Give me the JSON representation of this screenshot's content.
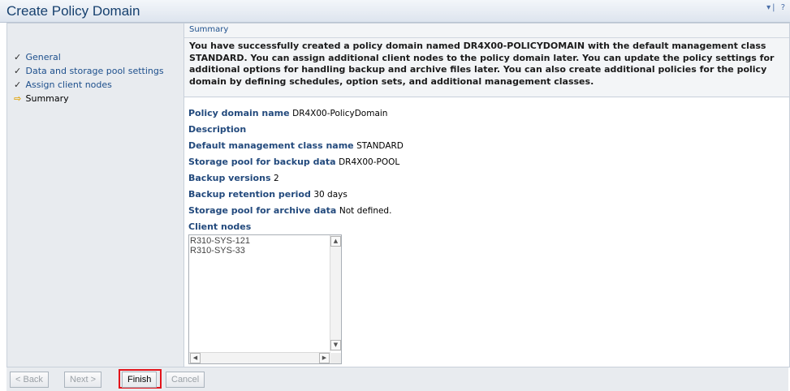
{
  "window": {
    "title": "Create Policy Domain",
    "controls": "▾| ?"
  },
  "sidebar": {
    "steps": [
      {
        "label": "General",
        "mark": "✓"
      },
      {
        "label": "Data and storage pool settings",
        "mark": "✓"
      },
      {
        "label": "Assign client nodes",
        "mark": "✓"
      },
      {
        "label": "Summary",
        "mark": "⇨"
      }
    ]
  },
  "main": {
    "breadcrumb": "Summary",
    "message": "You have successfully created a policy domain named DR4X00-POLICYDOMAIN with the default management class STANDARD. You can assign additional client nodes to the policy domain later. You can update the policy settings for additional options for handling backup and archive files later. You can also create additional policies for the policy domain by defining schedules, option sets, and additional management classes.",
    "fields": [
      {
        "label": "Policy domain name",
        "value": "DR4X00-PolicyDomain"
      },
      {
        "label": "Description",
        "value": ""
      },
      {
        "label": "Default management class name",
        "value": "STANDARD"
      },
      {
        "label": "Storage pool for backup data",
        "value": "DR4X00-POOL"
      },
      {
        "label": "Backup versions",
        "value": "2"
      },
      {
        "label": "Backup retention period",
        "value": "30 days"
      },
      {
        "label": "Storage pool for archive data",
        "value": "Not defined."
      }
    ],
    "client_nodes": {
      "label": "Client nodes",
      "items": [
        "R310-SYS-121",
        "R310-SYS-33"
      ]
    }
  },
  "footer": {
    "back": "< Back",
    "next": "Next >",
    "finish": "Finish",
    "cancel": "Cancel"
  },
  "colors": {
    "title": "#16406e",
    "link": "#1d4f8c",
    "field_label": "#234a7d",
    "highlight": "#e3141b"
  }
}
